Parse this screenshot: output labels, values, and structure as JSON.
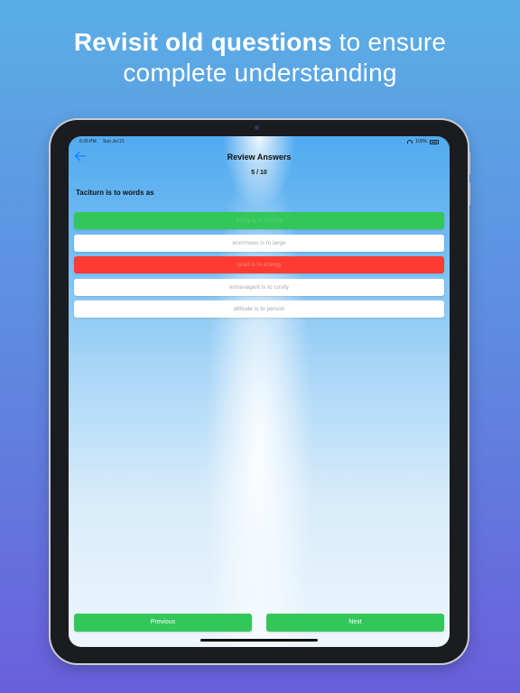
{
  "headline": {
    "bold_part": "Revisit old questions",
    "rest_part": " to ensure",
    "line2": "complete understanding"
  },
  "status_bar": {
    "time": "6:25 PM",
    "date": "Sun Jul 21",
    "battery": "100%"
  },
  "nav": {
    "title": "Review Answers",
    "back_icon": "arrow-left-icon"
  },
  "progress": "5 / 10",
  "question": "Taciturn is to words as",
  "answers": [
    {
      "text": "thrifty is to money",
      "state": "correct"
    },
    {
      "text": "enormous is to large",
      "state": "neutral"
    },
    {
      "text": "quiet is to energy",
      "state": "wrong"
    },
    {
      "text": "extravagant is to costly",
      "state": "neutral"
    },
    {
      "text": "attitude is to person",
      "state": "neutral"
    }
  ],
  "buttons": {
    "previous": "Previous",
    "next": "Next"
  },
  "colors": {
    "correct": "#33c759",
    "wrong": "#fe3b30",
    "accent": "#0a84ff"
  }
}
